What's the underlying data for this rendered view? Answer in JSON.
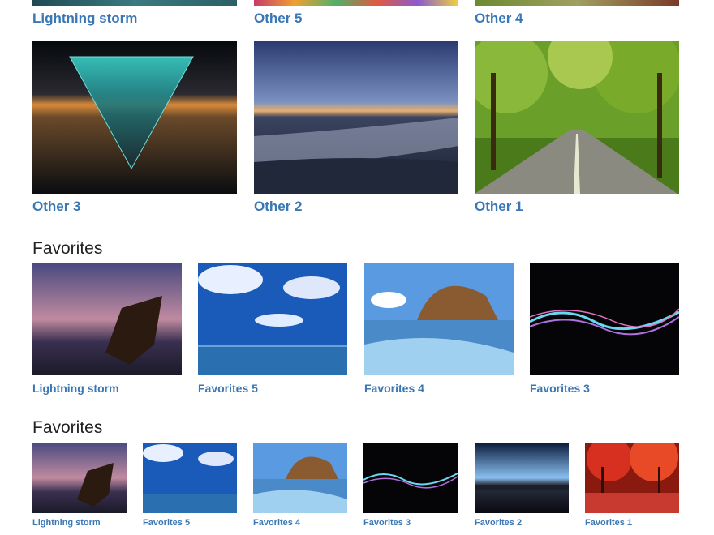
{
  "top_row": {
    "captions": [
      "Lightning storm",
      "Other 5",
      "Other 4"
    ]
  },
  "grid_large": {
    "items": [
      {
        "caption": "Other 3"
      },
      {
        "caption": "Other 2"
      },
      {
        "caption": "Other 1"
      }
    ]
  },
  "section_medium": {
    "heading": "Favorites",
    "items": [
      {
        "caption": "Lightning storm"
      },
      {
        "caption": "Favorites 5"
      },
      {
        "caption": "Favorites 4"
      },
      {
        "caption": "Favorites 3"
      }
    ]
  },
  "section_small": {
    "heading": "Favorites",
    "items": [
      {
        "caption": "Lightning storm"
      },
      {
        "caption": "Favorites 5"
      },
      {
        "caption": "Favorites 4"
      },
      {
        "caption": "Favorites 3"
      },
      {
        "caption": "Favorites 2"
      },
      {
        "caption": "Favorites 1"
      }
    ]
  },
  "colors": {
    "link": "#3a78b5",
    "heading": "#222222"
  }
}
